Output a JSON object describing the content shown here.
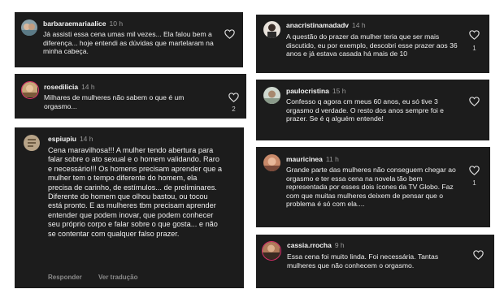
{
  "comments": [
    {
      "username": "barbaraemariaalice",
      "time": "10 h",
      "text": "Já assisti essa cena umas mil vezes... Ela falou bem a diferença... hoje entendi as dúvidas que martelaram na minha cabeça.",
      "likes": ""
    },
    {
      "username": "rosedilicia",
      "time": "14 h",
      "text": "Milhares de mulheres não sabem o que é um orgasmo...",
      "likes": "2"
    },
    {
      "username": "espiupiu",
      "time": "14 h",
      "text": "Cena maravilhosa!!! A mulher tendo abertura para falar sobre o ato sexual e o homem validando. Raro e necessário!!! Os homens precisam aprender que a mulher tem o tempo diferente do homem, ela precisa de carinho, de estímulos... de preliminares. Diferente do homem que olhou bastou, ou tocou está pronto.  E as mulheres tbm precisam aprender entender que podem inovar, que podem conhecer seu próprio corpo e falar sobre o que gosta... e não se contentar com qualquer  falso prazer.",
      "likes": "",
      "actions": {
        "reply": "Responder",
        "translate": "Ver tradução"
      }
    },
    {
      "username": "anacristinamadadv",
      "time": "14 h",
      "text": "A questão do prazer da mulher teria que ser mais discutido, eu por exemplo,  descobri esse prazer aos 36 anos e já estava casada há mais de 10",
      "likes": "1"
    },
    {
      "username": "paulocristina",
      "time": "15 h",
      "text": "Confesso q agora cm meus 60 anos, eu só tive 3 orgasmo d verdade. O resto dos anos sempre foi e prazer. Se é q alguém entende!",
      "likes": ""
    },
    {
      "username": "mauricinea",
      "time": "11 h",
      "text": "Grande parte das mulheres não conseguem chegar ao orgasmo e ter essa cena na novela tão bem representada por esses dois ícones da TV Globo. Faz com que muitas mulheres deixem de pensar que o problema é só com ela....",
      "likes": "1"
    },
    {
      "username": "cassia.rrocha",
      "time": "9 h",
      "text": "Essa cena foi muito linda. Foi necessária. Tantas mulheres que não conhecem o orgasmo.",
      "likes": ""
    }
  ],
  "colors": {
    "card_bg": "#1c1c1c",
    "story_ring": "#e1306c",
    "muted": "#9a9a9a"
  },
  "icons": {
    "like": "heart-outline-icon"
  }
}
